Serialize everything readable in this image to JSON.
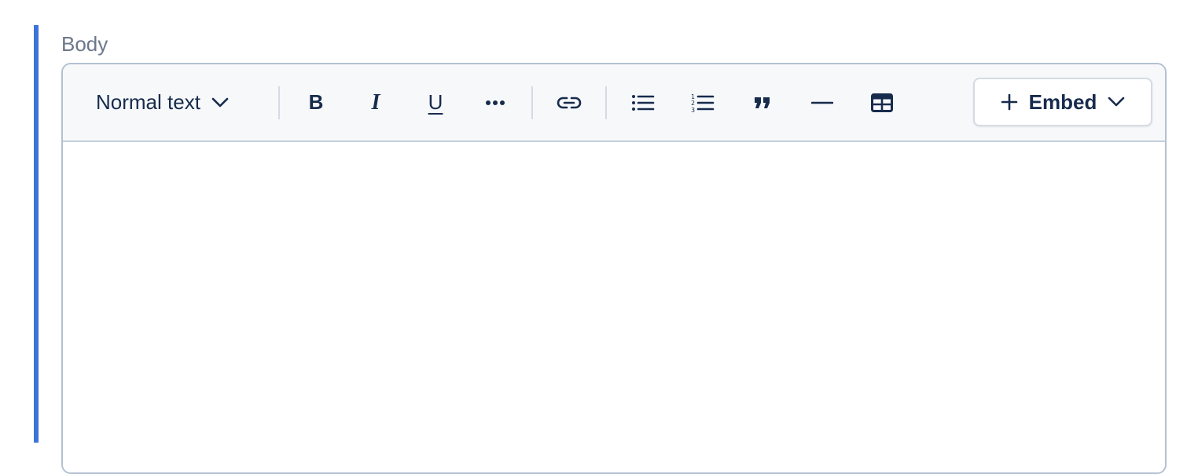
{
  "field": {
    "label": "Body"
  },
  "toolbar": {
    "text_style": {
      "selected": "Normal text",
      "icon": "chevron-down-icon"
    },
    "buttons": [
      {
        "name": "bold",
        "glyph": "B",
        "icon": "bold-icon"
      },
      {
        "name": "italic",
        "glyph": "I",
        "icon": "italic-icon"
      },
      {
        "name": "underline",
        "glyph": "U",
        "icon": "underline-icon"
      },
      {
        "name": "more-formatting",
        "icon": "more-dots-icon"
      },
      {
        "name": "link",
        "icon": "link-icon"
      },
      {
        "name": "bullet-list",
        "icon": "bullet-list-icon"
      },
      {
        "name": "numbered-list",
        "icon": "numbered-list-icon"
      },
      {
        "name": "quote",
        "icon": "quote-icon"
      },
      {
        "name": "divider",
        "icon": "horizontal-rule-icon"
      },
      {
        "name": "table",
        "icon": "table-icon"
      }
    ],
    "embed": {
      "label": "Embed",
      "icon": "plus-icon",
      "dropdown_icon": "chevron-down-icon"
    }
  },
  "editor": {
    "content": ""
  },
  "colors": {
    "accent": "#3b73d9",
    "text": "#172b4d",
    "label": "#6b778c",
    "toolbar_bg": "#f6f8fa",
    "border": "#b3c0d1"
  }
}
